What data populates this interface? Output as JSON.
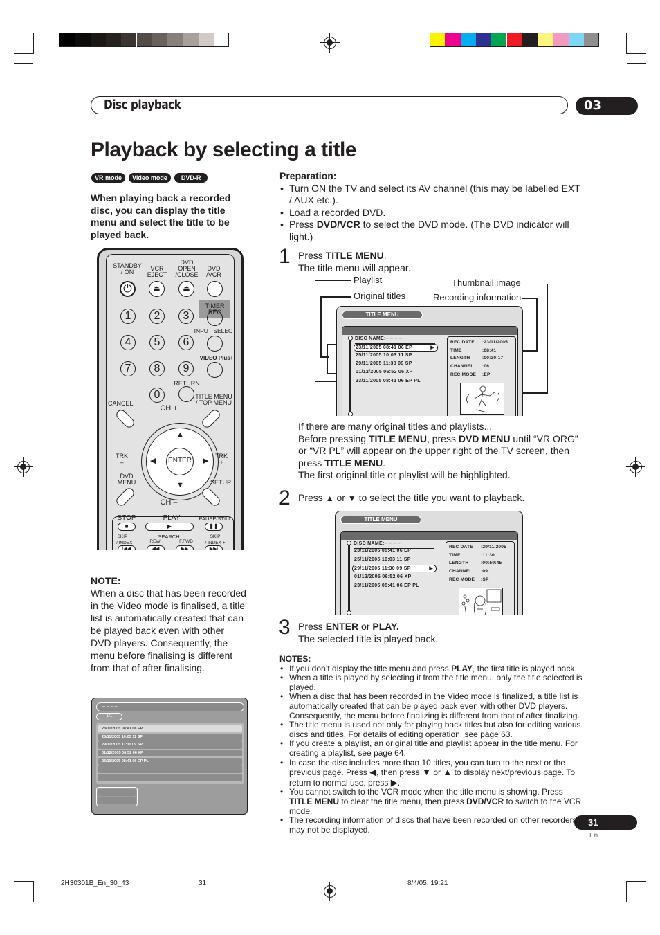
{
  "print_marks": {
    "grayscale_swatches": [
      "#000000",
      "#0d0b0a",
      "#1a1715",
      "#262220",
      "#3b3431",
      "#544a46",
      "#6b605c",
      "#8a7e79",
      "#aa9f9b",
      "#d3cac8",
      "#ffffff"
    ],
    "color_swatches": [
      "#fff200",
      "#ec008c",
      "#00aeef",
      "#2e3192",
      "#00a651",
      "#ed1c24",
      "#231f20",
      "#fff57c",
      "#f49ac1",
      "#7fd5f6",
      "#8f8f8f"
    ]
  },
  "header": {
    "section_title": "Disc playback",
    "chapter_number": "03"
  },
  "page_title": "Playback by selecting a title",
  "badges": [
    "VR mode",
    "Video mode",
    "DVD-R"
  ],
  "intro": "When playing back a recorded disc, you can display the title menu and select the title to be played back.",
  "remote": {
    "labels": {
      "standby": "STANDBY\n/ ON",
      "vcr_eject": "VCR\nEJECT",
      "dvd_open_close": "DVD\nOPEN\n/CLOSE",
      "dvd_vcr": "DVD\n/VCR",
      "timer_rec": "TIMER REC",
      "input_select": "INPUT SELECT",
      "video_plus": "VIDEO Plus+",
      "return": "RETURN",
      "title_menu": "TITLE MENU\n/ TOP MENU",
      "cancel": "CANCEL",
      "ch_plus": "CH +",
      "ch_minus": "CH –",
      "trk_minus": "TRK\n–",
      "trk_plus": "TRK\n+",
      "dvd_menu": "DVD\nMENU",
      "setup": "SETUP",
      "enter": "ENTER",
      "stop": "STOP",
      "play": "PLAY",
      "pause_still": "PAUSE/STILL",
      "skip_index_minus": "SKIP\n– / INDEX",
      "search": "SEARCH",
      "rew": "REW",
      "ffwd": "F.FWD",
      "skip_index_plus": "SKIP\n/ INDEX +"
    },
    "number_keys": [
      "1",
      "2",
      "3",
      "4",
      "5",
      "6",
      "7",
      "8",
      "9",
      "0"
    ]
  },
  "note_left": {
    "heading": "NOTE:",
    "body": "When a disc that has been recorded in the Video mode is finalised, a title list is automatically created that can be played back even with other DVD players. Consequently, the menu before finalising is different from that of after finalising."
  },
  "finalised_menu": {
    "disc_name": "– – – –",
    "page": "1/1",
    "rows": [
      "23/11/2005 08:41 06 EP",
      "25/11/2005 10:03 11 SP",
      "29/11/2005 11:30 09 SP",
      "01/12/2005 06:52 06 XP",
      "23/11/2005 08:41 06 EP PL",
      "",
      ""
    ],
    "selected_index": 0
  },
  "preparation": {
    "heading": "Preparation:",
    "items": [
      "Turn ON the TV and select its AV channel (this may be labelled EXT / AUX etc.).",
      "Load a recorded DVD.",
      "Press DVD/VCR to select the DVD mode. (The DVD indicator will light.)"
    ]
  },
  "steps": [
    {
      "number": "1",
      "line1_pre": "Press ",
      "line1_bold": "TITLE MENU",
      "line1_post": ".",
      "line2": "The title menu will appear."
    },
    {
      "number": "2",
      "pre": "Press",
      "mid": "or",
      "post": "to select the title you want to playback."
    },
    {
      "number": "3",
      "pre": "Press ",
      "bold1": "ENTER",
      "mid": " or ",
      "bold2": "PLAY.",
      "line2": "The selected title is played back."
    }
  ],
  "callouts": {
    "playlist": "Playlist",
    "original_titles": "Original titles",
    "thumbnail_image": "Thumbnail image",
    "recording_information": "Recording information"
  },
  "title_menu_1": {
    "header": "TITLE MENU",
    "disc_name": "DISC NAME:– – – –",
    "rows": [
      "23/11/2005 08:41 06 EP",
      "25/11/2005 10:03 11 SP",
      "29/11/2005 11:30 09 SP",
      "01/12/2005 06:52 06 XP",
      "23/11/2005 08:41 06 EP PL"
    ],
    "selected_index": 0,
    "info": [
      {
        "key": "REC DATE",
        "value": ":23/11/2005"
      },
      {
        "key": "TIME",
        "value": ":08:41"
      },
      {
        "key": "LENGTH",
        "value": ":00:30:17"
      },
      {
        "key": "CHANNEL",
        "value": ":06"
      },
      {
        "key": "REC MODE",
        "value": ":EP"
      }
    ]
  },
  "many_titles_text": {
    "line1": "If there are many original titles and playlists...",
    "line2_parts": [
      "Before pressing ",
      "TITLE MENU",
      ", press ",
      "DVD MENU",
      " until “VR ORG”"
    ],
    "line3": "or “VR PL” will appear on the upper right of the TV screen, then",
    "line4_parts": [
      "press ",
      "TITLE MENU",
      "."
    ],
    "line5": "The first original title or playlist will be highlighted."
  },
  "title_menu_2": {
    "header": "TITLE MENU",
    "disc_name": "DISC NAME:– – – –",
    "rows": [
      "23/11/2005 08:41 06 EP",
      "25/11/2005 10:03 11 SP",
      "29/11/2005 11:30 09 SP",
      "01/12/2005 06:52 06 XP",
      "23/11/2005 08:41 06 EP PL"
    ],
    "selected_index": 2,
    "info": [
      {
        "key": "REC DATE",
        "value": ":29/11/2005"
      },
      {
        "key": "TIME",
        "value": ":11:30"
      },
      {
        "key": "LENGTH",
        "value": ":00:59:45"
      },
      {
        "key": "CHANNEL",
        "value": ":09"
      },
      {
        "key": "REC MODE",
        "value": ":SP"
      }
    ]
  },
  "notes": {
    "heading": "NOTES:",
    "items": [
      {
        "parts": [
          "If you don’t display the title menu and press ",
          "PLAY",
          ", the first title is played back."
        ]
      },
      {
        "parts": [
          "When a title is played by selecting it from the title menu, only the title selected is played."
        ]
      },
      {
        "parts": [
          "When a disc that has been recorded in the Video mode is finalized, a title list is automatically created that can be played back even with other DVD players. Consequently, the menu before finalizing is different from that of after finalizing."
        ]
      },
      {
        "parts": [
          "The title menu is used not only for playing back titles but also for editing various discs and titles. For details of editing operation, see page 63."
        ]
      },
      {
        "parts": [
          "If you create a playlist, an original title and playlist appear in the title menu. For creating a playlist, see page 64."
        ]
      },
      {
        "parts": [
          "In case the disc includes more than 10 titles, you can turn to the next or the previous page. Press ",
          "◀",
          ", then press ",
          "▼",
          " or ",
          "▲",
          " to display next/previous page. To return to normal use, press ",
          "▶",
          "."
        ]
      },
      {
        "parts": [
          "You cannot switch to the VCR mode when the title menu is showing. Press ",
          "TITLE MENU",
          " to clear the title menu, then press ",
          "DVD/VCR",
          " to switch to the VCR mode."
        ]
      },
      {
        "parts": [
          "The recording information of discs that have been recorded on other recorders may not be displayed."
        ]
      }
    ]
  },
  "page_number": "31",
  "page_lang": "En",
  "footer": {
    "file": "2H30301B_En_30_43",
    "page": "31",
    "date": "8/4/05, 19:21"
  }
}
